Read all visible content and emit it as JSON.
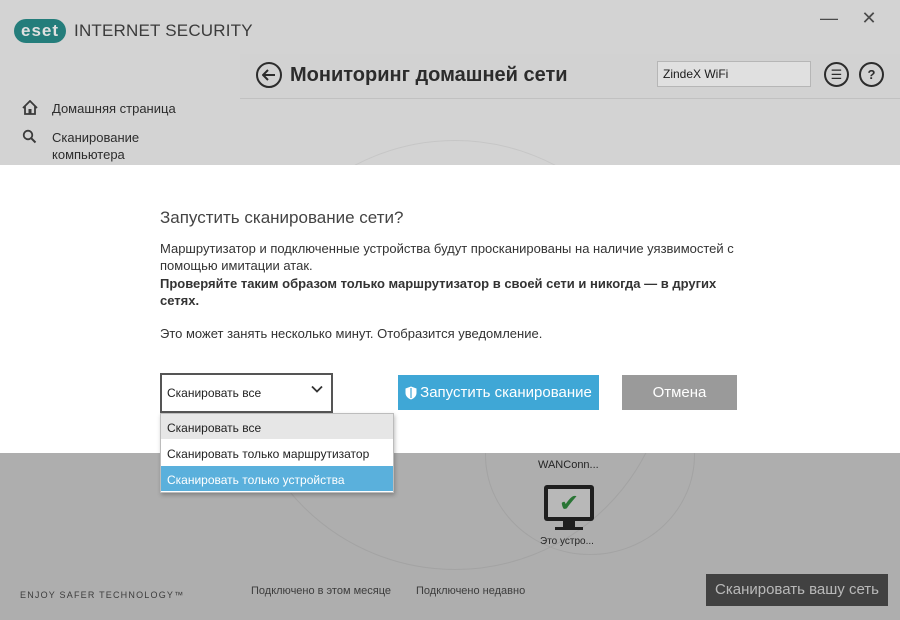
{
  "app": {
    "brand": "eset",
    "product": "INTERNET SECURITY",
    "window_controls": {
      "minimize": "—",
      "close": "✕"
    }
  },
  "sidebar": {
    "items": [
      {
        "icon": "home-icon",
        "label": "Домашняя страница"
      },
      {
        "icon": "search-icon",
        "label": "Сканирование компьютера"
      }
    ]
  },
  "header": {
    "title": "Мониторинг домашней сети",
    "network_name": "ZindeX WiFi",
    "menu_icon": "☰",
    "help_icon": "?"
  },
  "network_map": {
    "router_label": "WANConn...",
    "device_label": "Это устро..."
  },
  "footer": {
    "tagline": "ENJOY SAFER TECHNOLOGY™",
    "legend": [
      "Подключено в этом месяце",
      "Подключено недавно"
    ],
    "scan_button": "Сканировать вашу сеть"
  },
  "dialog": {
    "title": "Запустить сканирование сети?",
    "text": "Маршрутизатор и подключенные устройства будут просканированы на наличие уязвимостей с помощью имитации атак.",
    "warning": "Проверяйте таким образом только маршрутизатор в своей сети и никогда — в других сетях.",
    "note": "Это может занять несколько минут. Отобразится уведомление.",
    "select_value": "Сканировать все",
    "start_button": "Запустить сканирование",
    "cancel_button": "Отмена",
    "options": [
      "Сканировать все",
      "Сканировать только маршрутизатор",
      "Сканировать только устройства"
    ]
  },
  "colors": {
    "brand": "#2a8f8d",
    "primary_button": "#3fa7d6",
    "cancel_button": "#9a9a9a",
    "highlight": "#5ab0dc",
    "check": "#3aa34a"
  }
}
